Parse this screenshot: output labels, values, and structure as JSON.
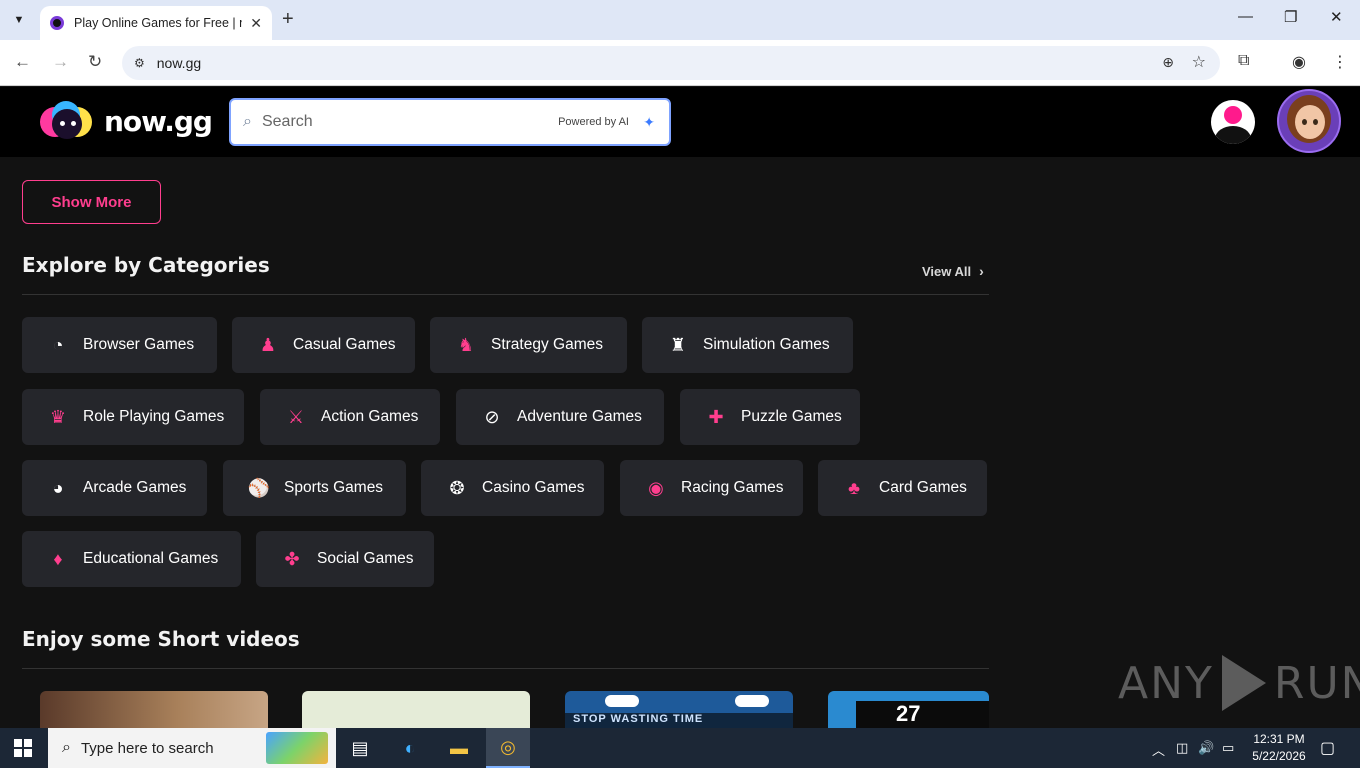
{
  "browser": {
    "tab_title": "Play Online Games for Free | now.gg",
    "url": "now.gg",
    "new_tab": "+",
    "tab_close": "✕"
  },
  "site": {
    "logo_text": "now.gg",
    "search_placeholder": "Search",
    "powered_by": "Powered by AI"
  },
  "main": {
    "show_more_label": "Show More",
    "categories_title": "Explore by Categories",
    "view_all_label": "View All",
    "categories": [
      {
        "label": "Browser Games",
        "icon": "browser-games-icon"
      },
      {
        "label": "Casual Games",
        "icon": "joystick-icon"
      },
      {
        "label": "Strategy Games",
        "icon": "chess-knight-icon"
      },
      {
        "label": "Simulation Games",
        "icon": "simulation-icon"
      },
      {
        "label": "Role Playing Games",
        "icon": "role-playing-icon"
      },
      {
        "label": "Action Games",
        "icon": "sword-icon"
      },
      {
        "label": "Adventure Games",
        "icon": "compass-icon"
      },
      {
        "label": "Puzzle Games",
        "icon": "puzzle-icon"
      },
      {
        "label": "Arcade Games",
        "icon": "pacman-icon"
      },
      {
        "label": "Sports Games",
        "icon": "baseball-icon"
      },
      {
        "label": "Casino Games",
        "icon": "casino-chip-icon"
      },
      {
        "label": "Racing Games",
        "icon": "racing-icon"
      },
      {
        "label": "Card Games",
        "icon": "card-icon"
      },
      {
        "label": "Educational Games",
        "icon": "educational-icon"
      },
      {
        "label": "Social Games",
        "icon": "social-icon"
      }
    ],
    "videos_title": "Enjoy some Short videos",
    "video_thumb_3_text": "STOP WASTING TIME",
    "video_thumb_4_text": "27"
  },
  "watermark": {
    "text_left": "ANY",
    "text_right": "RUN"
  },
  "taskbar": {
    "search_placeholder": "Type here to search",
    "time": "12:31 PM",
    "date": "5/22/2026"
  },
  "colors": {
    "accent": "#ff3e8e",
    "background": "#121212",
    "card": "#25262b"
  }
}
